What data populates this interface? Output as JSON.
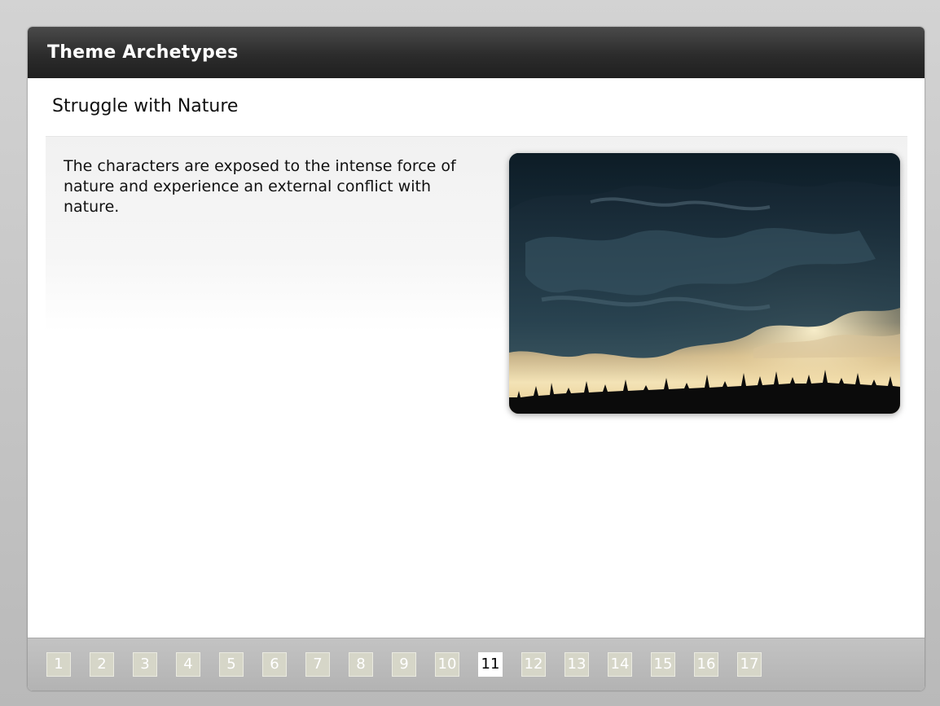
{
  "window": {
    "title": "Theme Archetypes"
  },
  "slide": {
    "title": "Struggle with Nature",
    "body": "The characters are exposed to the intense force of nature and experience an external conflict with nature.",
    "image_icon": "storm-clouds-photo"
  },
  "pagination": {
    "current": 11,
    "pages": [
      "1",
      "2",
      "3",
      "4",
      "5",
      "6",
      "7",
      "8",
      "9",
      "10",
      "11",
      "12",
      "13",
      "14",
      "15",
      "16",
      "17"
    ]
  },
  "colors": {
    "titlebar": "#2c2c2c",
    "page_button": "#d6d6c8",
    "page_button_active": "#ffffff"
  }
}
